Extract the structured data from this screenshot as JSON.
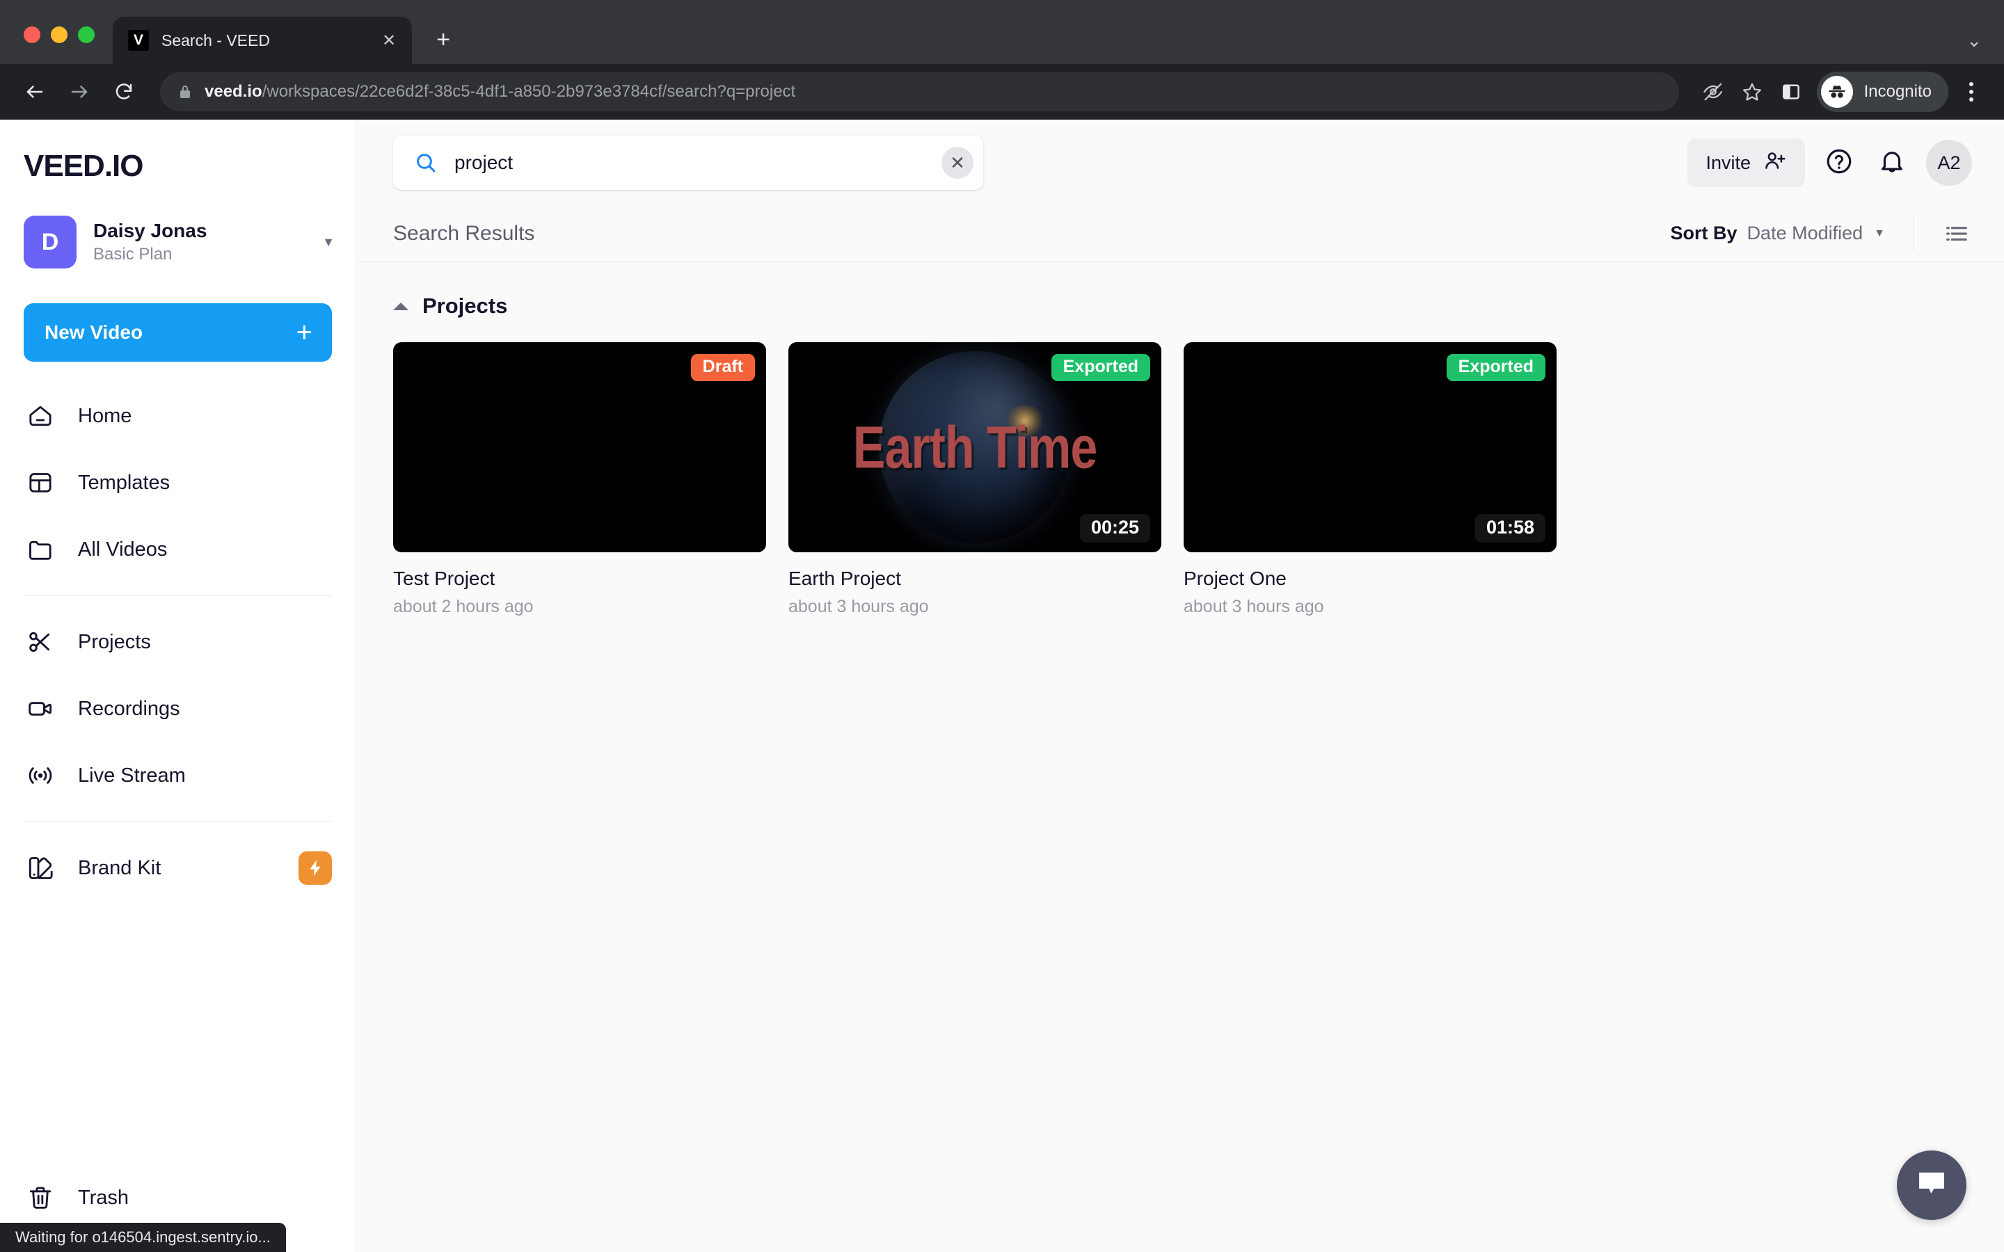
{
  "browser": {
    "tab": {
      "favicon_letter": "V",
      "title": "Search - VEED",
      "close_icon": "close-icon"
    },
    "new_tab_label": "+",
    "collapse_icon": "chevron-down-icon",
    "url": {
      "host": "veed.io",
      "path": "/workspaces/22ce6d2f-38c5-4df1-a850-2b973e3784cf/search?q=project"
    },
    "icons": {
      "back": "back-arrow-icon",
      "forward": "forward-arrow-icon",
      "reload": "reload-icon",
      "lock": "lock-icon",
      "tracking": "eye-slash-icon",
      "bookmark": "star-icon",
      "sidepanel": "side-panel-icon",
      "menu": "kebab-menu-icon"
    },
    "profile_label": "Incognito",
    "status_text": "Waiting for o146504.ingest.sentry.io..."
  },
  "sidebar": {
    "brand": "VEED.IO",
    "account": {
      "initial": "D",
      "name": "Daisy Jonas",
      "plan": "Basic Plan"
    },
    "new_video": {
      "label": "New Video",
      "plus": "+"
    },
    "nav": [
      {
        "label": "Home",
        "icon": "home-icon"
      },
      {
        "label": "Templates",
        "icon": "templates-icon"
      },
      {
        "label": "All Videos",
        "icon": "folder-icon"
      },
      {
        "label": "Projects",
        "icon": "scissors-icon"
      },
      {
        "label": "Recordings",
        "icon": "video-camera-icon"
      },
      {
        "label": "Live Stream",
        "icon": "broadcast-icon"
      },
      {
        "label": "Brand Kit",
        "icon": "brand-kit-icon",
        "badge": "lightning-icon"
      }
    ],
    "trash": {
      "label": "Trash",
      "icon": "trash-icon"
    }
  },
  "header": {
    "search": {
      "value": "project",
      "placeholder": "Search",
      "icon": "search-icon",
      "clear_icon": "close-icon"
    },
    "invite": {
      "label": "Invite",
      "icon": "add-person-icon"
    },
    "help_icon": "question-circle-icon",
    "notifications_icon": "bell-icon",
    "avatar_initials": "A2"
  },
  "results": {
    "title": "Search Results",
    "sort": {
      "label": "Sort By",
      "value": "Date Modified",
      "caret": "chevron-down-icon"
    },
    "view_toggle_icon": "list-view-icon",
    "section": {
      "title": "Projects",
      "caret": "chevron-up-icon"
    },
    "cards": [
      {
        "name": "Test Project",
        "time": "about 2 hours ago",
        "status": "Draft",
        "status_kind": "draft",
        "duration": "",
        "thumb_text": ""
      },
      {
        "name": "Earth Project",
        "time": "about 3 hours ago",
        "status": "Exported",
        "status_kind": "exported",
        "duration": "00:25",
        "thumb_text": "Earth Time"
      },
      {
        "name": "Project One",
        "time": "about 3 hours ago",
        "status": "Exported",
        "status_kind": "exported",
        "duration": "01:58",
        "thumb_text": ""
      }
    ]
  },
  "chat": {
    "icon": "chat-bubble-icon"
  },
  "colors": {
    "accent_blue": "#149df2",
    "avatar_purple": "#6b63f6",
    "draft_orange": "#f4623a",
    "exported_green": "#1fc16b",
    "badge_orange": "#ef9130",
    "chat_slate": "#4e5168",
    "search_icon_blue": "#1a85f6"
  }
}
